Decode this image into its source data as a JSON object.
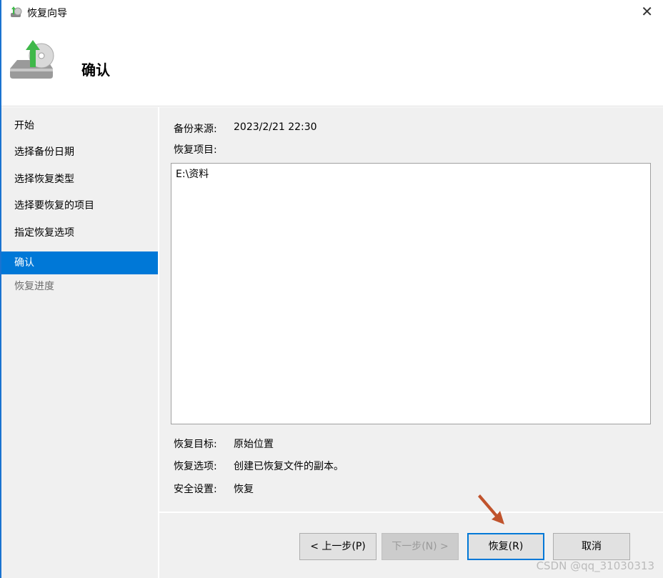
{
  "window": {
    "title": "恢复向导",
    "close": "✕"
  },
  "header": {
    "title": "确认"
  },
  "sidebar": {
    "items": [
      {
        "label": "开始",
        "state": "normal"
      },
      {
        "label": "选择备份日期",
        "state": "normal"
      },
      {
        "label": "选择恢复类型",
        "state": "normal"
      },
      {
        "label": "选择要恢复的项目",
        "state": "normal"
      },
      {
        "label": "指定恢复选项",
        "state": "normal"
      },
      {
        "label": "确认",
        "state": "active"
      },
      {
        "label": "恢复进度",
        "state": "disabled"
      }
    ]
  },
  "main": {
    "source_label": "备份来源:",
    "source_value": "2023/2/21 22:30",
    "items_label": "恢复项目:",
    "items": [
      "E:\\资料"
    ],
    "target_label": "恢复目标:",
    "target_value": "原始位置",
    "options_label": "恢复选项:",
    "options_value": "创建已恢复文件的副本。",
    "security_label": "安全设置:",
    "security_value": "恢复"
  },
  "buttons": {
    "back": "< 上一步(P)",
    "next": "下一步(N) >",
    "recover": "恢复(R)",
    "cancel": "取消"
  },
  "watermark": "CSDN @qq_31030313",
  "colors": {
    "accent": "#0078d7",
    "arrow": "#c0532c"
  }
}
